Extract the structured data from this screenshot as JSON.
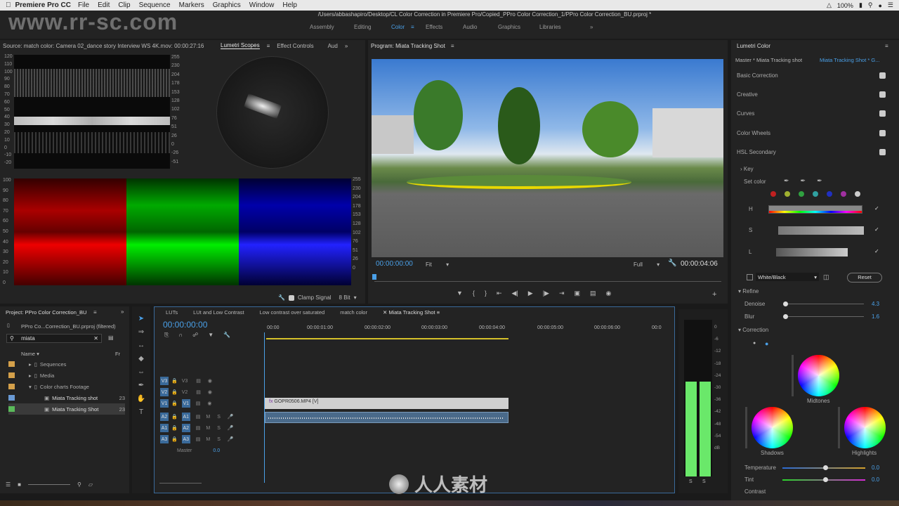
{
  "menubar": {
    "app": "Premiere Pro CC",
    "items": [
      "File",
      "Edit",
      "Clip",
      "Sequence",
      "Markers",
      "Graphics",
      "Window",
      "Help"
    ],
    "battery": "100%",
    "time_icons": "status-icons"
  },
  "title_path": "/Users/abbashapiro/Desktop/CL Color Correction in Premiere Pro/Copied_PPro Color Correction_1/PPro Color Correction_BU.prproj *",
  "workspaces": [
    "Assembly",
    "Editing",
    "Color",
    "Effects",
    "Audio",
    "Graphics",
    "Libraries"
  ],
  "active_workspace": "Color",
  "watermark": "www.rr-sc.com",
  "source_panel": {
    "title": "Source: match color: Camera 02_dance story Interview WS 4K.mov: 00:00:27:16",
    "tabs": [
      "Lumetri Scopes",
      "Effect Controls",
      "Aud"
    ],
    "left_scale": [
      "120",
      "110",
      "100",
      "90",
      "80",
      "70",
      "60",
      "50",
      "40",
      "30",
      "20",
      "10",
      "0",
      "-10",
      "-20"
    ],
    "right_scale": [
      "255",
      "230",
      "204",
      "178",
      "153",
      "128",
      "102",
      "76",
      "51",
      "26",
      "0",
      "-26",
      "-51"
    ],
    "parade_left": [
      "100",
      "90",
      "80",
      "70",
      "60",
      "50",
      "40",
      "30",
      "20",
      "10",
      "0"
    ],
    "parade_right": [
      "255",
      "230",
      "204",
      "178",
      "153",
      "128",
      "102",
      "76",
      "51",
      "26",
      "0"
    ],
    "clamp": "Clamp Signal",
    "bit": "8 Bit"
  },
  "program": {
    "title": "Program: Miata Tracking Shot",
    "timecode": "00:00:00:00",
    "fit": "Fit",
    "quality": "Full",
    "duration": "00:00:04:06"
  },
  "lumetri": {
    "title": "Lumetri Color",
    "master": "Master * Miata Tracking shot",
    "clip": "Miata Tracking Shot * G...",
    "sections": [
      "Basic Correction",
      "Creative",
      "Curves",
      "Color Wheels",
      "HSL Secondary"
    ],
    "key": "Key",
    "set_color": "Set color",
    "hsl": [
      "H",
      "S",
      "L"
    ],
    "white_black": "White/Black",
    "reset": "Reset",
    "refine": "Refine",
    "denoise": "Denoise",
    "denoise_val": "4.3",
    "blur": "Blur",
    "blur_val": "1.6",
    "correction": "Correction",
    "midtones": "Midtones",
    "shadows": "Shadows",
    "highlights": "Highlights",
    "temperature": "Temperature",
    "temp_val": "0.0",
    "tint": "Tint",
    "tint_val": "0.0",
    "contrast": "Contrast"
  },
  "project": {
    "title": "Project: PPro Color Correction_BU",
    "file": "PPro Co...Correction_BU.prproj (filtered)",
    "search": "miata",
    "col_name": "Name",
    "col_fr": "Fr",
    "items": [
      {
        "name": "Sequences",
        "color": "#d4a04a",
        "fr": ""
      },
      {
        "name": "Media",
        "color": "#d4a04a",
        "fr": ""
      },
      {
        "name": "Color charts Footage",
        "color": "#d4a04a",
        "fr": ""
      },
      {
        "name": "Miata Tracking shot",
        "color": "#6a9ad4",
        "fr": "23"
      },
      {
        "name": "Miata Tracking Shot",
        "color": "#5aba5a",
        "fr": "23"
      }
    ]
  },
  "timeline": {
    "tabs": [
      "LUTs",
      "LUt and Low Contrast",
      "Low contrast over saturated",
      "match color",
      "Miata Tracking Shot"
    ],
    "timecode": "00:00:00:00",
    "ruler": [
      "00:00",
      "00:00:01:00",
      "00:00:02:00",
      "00:00:03:00",
      "00:00:04:00",
      "00:00:05:00",
      "00:00:06:00",
      "00:0"
    ],
    "video_tracks": [
      "V3",
      "V2",
      "V1"
    ],
    "audio_tracks": [
      "A2",
      "A1",
      "A3"
    ],
    "src_video": [
      "V3",
      "V2",
      "V1"
    ],
    "src_audio": [
      "A1",
      "A2",
      "A3"
    ],
    "master": "Master",
    "master_val": "0.0",
    "clip": "GOPR0506.MP4 [V]"
  },
  "meter": {
    "scale": [
      "0",
      "-6",
      "-12",
      "-18",
      "-24",
      "-30",
      "-36",
      "-42",
      "-48",
      "-54",
      "dB"
    ],
    "solo": [
      "S",
      "S"
    ]
  },
  "logo_text": "人人素材"
}
